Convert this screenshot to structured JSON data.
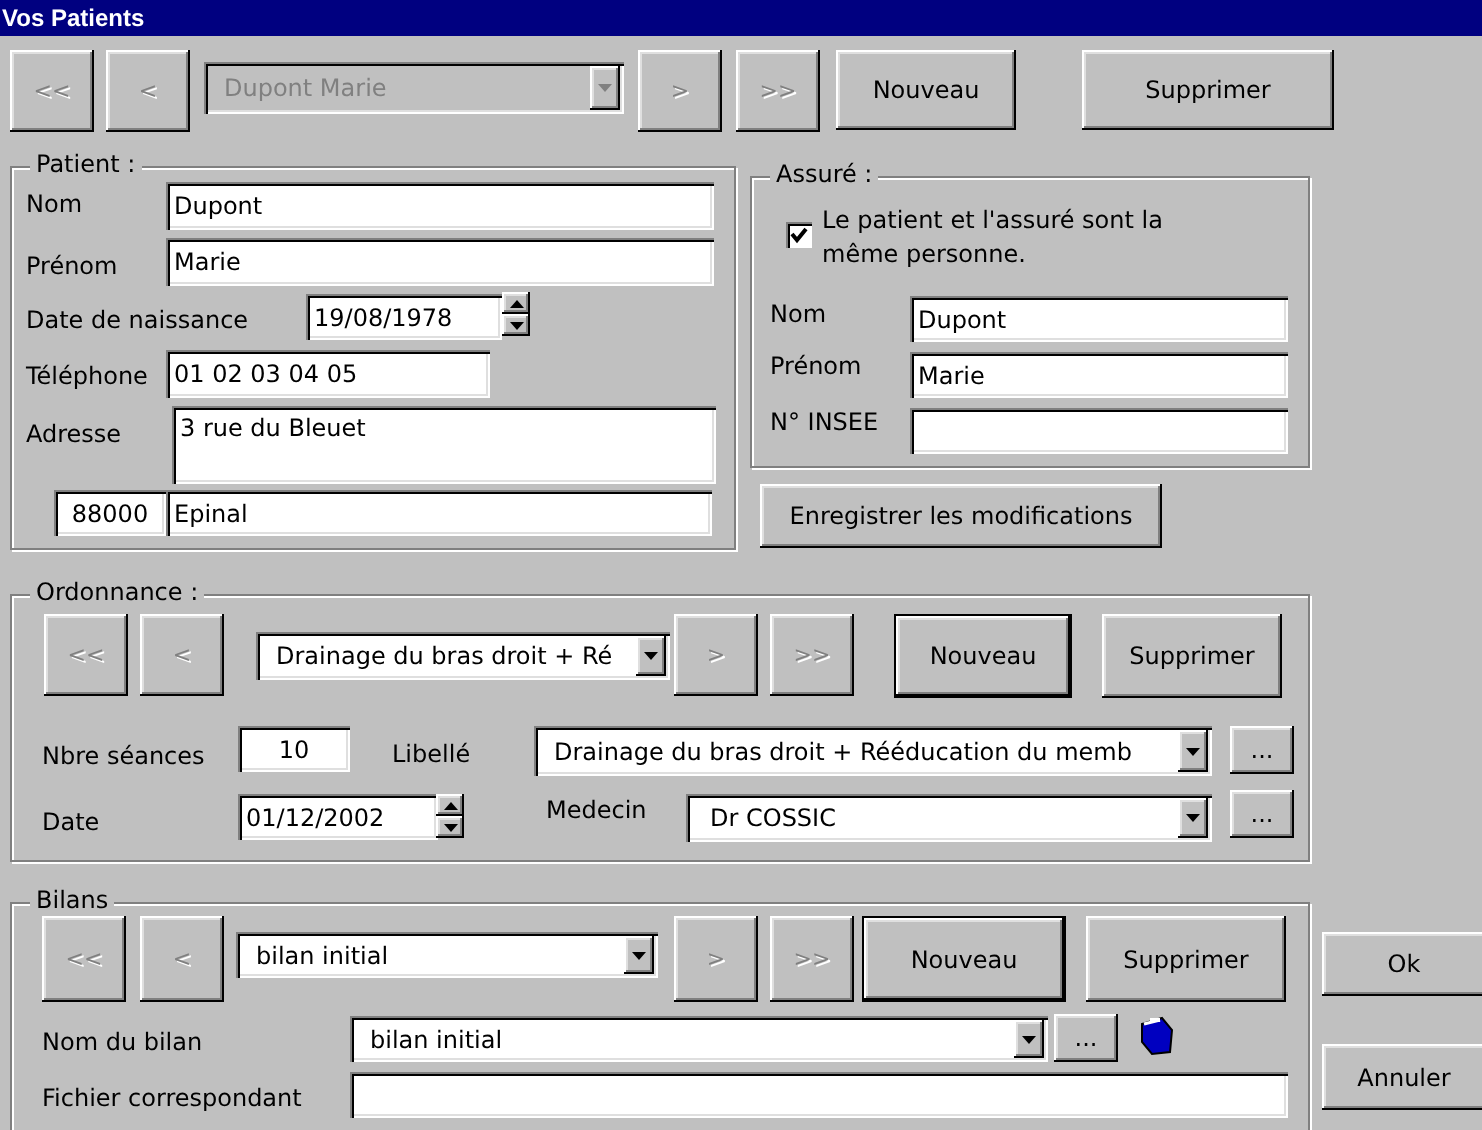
{
  "window": {
    "title": "Vos Patients"
  },
  "patients": {
    "nav": [
      {
        "label": "<<",
        "disabled": true
      },
      {
        "label": "<",
        "disabled": true
      },
      {
        "label": ">",
        "disabled": true
      },
      {
        "label": ">>",
        "disabled": true
      }
    ],
    "selector": {
      "value": "Dupont Marie",
      "disabled": true
    },
    "actions": [
      {
        "label": "Nouveau",
        "default": false
      },
      {
        "label": "Supprimer",
        "default": false
      }
    ]
  },
  "patient": {
    "legend": "Patient :",
    "fields": [
      {
        "label": "Nom",
        "value": "Dupont",
        "kind": "text"
      },
      {
        "label": "Prénom",
        "value": "Marie",
        "kind": "text"
      },
      {
        "label": "Date de naissance",
        "value": "19/08/1978",
        "kind": "date"
      },
      {
        "label": "Téléphone",
        "value": "01 02 03 04 05",
        "kind": "text"
      },
      {
        "label": "Adresse",
        "value": "3 rue du Bleuet",
        "kind": "multiline"
      }
    ],
    "postcode": "88000",
    "city": "Epinal"
  },
  "insured": {
    "legend": "Assuré :",
    "same_person": {
      "label": "Le patient et l'assuré sont la même personne.",
      "checked": true
    },
    "fields": [
      {
        "label": "Nom",
        "value": "Dupont"
      },
      {
        "label": "Prénom",
        "value": "Marie"
      },
      {
        "label": "N° INSEE"
      }
    ]
  },
  "save_button": "Enregistrer les modifications",
  "prescription": {
    "legend": "Ordonnance :",
    "nav": [
      {
        "label": "<<",
        "disabled": true
      },
      {
        "label": "<",
        "disabled": true
      },
      {
        "label": ">",
        "disabled": true
      },
      {
        "label": ">>",
        "disabled": true
      }
    ],
    "selector": {
      "value": "Drainage du bras droit + Ré",
      "disabled": false
    },
    "actions": [
      {
        "label": "Nouveau",
        "default": true
      },
      {
        "label": "Supprimer",
        "default": false
      }
    ],
    "sessions": {
      "label": "Nbre séances",
      "value": "10"
    },
    "title": {
      "label": "Libellé",
      "value": "Drainage du bras droit + Rééducation du memb",
      "browse": "..."
    },
    "date": {
      "label": "Date",
      "value": "01/12/2002"
    },
    "doctor": {
      "label": "Medecin",
      "value": "Dr COSSIC",
      "browse": "..."
    }
  },
  "assessments": {
    "legend": "Bilans",
    "nav": [
      {
        "label": "<<",
        "disabled": true
      },
      {
        "label": "<",
        "disabled": true
      },
      {
        "label": ">",
        "disabled": true
      },
      {
        "label": ">>",
        "disabled": true
      }
    ],
    "selector": {
      "value": "bilan initial",
      "disabled": false
    },
    "actions": [
      {
        "label": "Nouveau",
        "default": true
      },
      {
        "label": "Supprimer",
        "default": false
      }
    ],
    "name": {
      "label": "Nom du bilan",
      "value": "bilan initial",
      "browse": "..."
    },
    "file": {
      "label": "Fichier correspondant"
    }
  },
  "dialog_buttons": [
    {
      "label": "Ok"
    },
    {
      "label": "Annuler"
    }
  ]
}
